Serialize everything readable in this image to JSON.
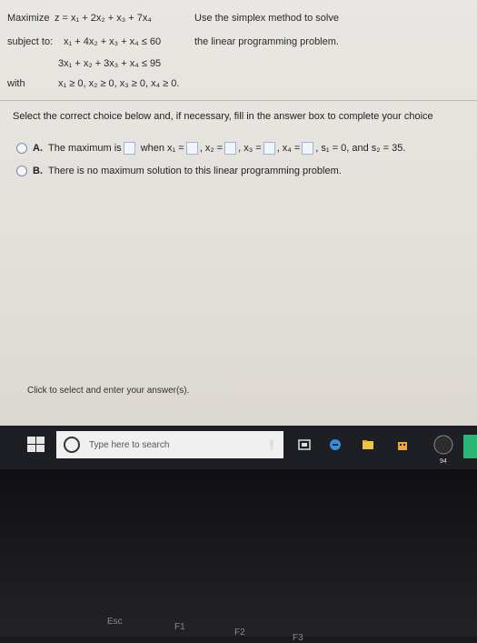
{
  "problem": {
    "maximize_label": "Maximize",
    "objective": "z = x₁ + 2x₂ + x₃ + 7x₄",
    "subject_label": "subject to:",
    "constraint1": "x₁ + 4x₂ + x₃ + x₄ ≤ 60",
    "constraint2": "3x₁ + x₂ + 3x₃ + x₄ ≤ 95",
    "with_label": "with",
    "nonneg": "x₁ ≥ 0, x₂ ≥ 0, x₃ ≥ 0, x₄ ≥ 0.",
    "hint_line1": "Use the simplex method to solve",
    "hint_line2": "the linear programming problem."
  },
  "instruction": "Select the correct choice below and, if necessary, fill in the answer box to complete your choice",
  "choices": {
    "a": {
      "letter": "A.",
      "text1": "The maximum is",
      "text2": "when x₁ =",
      "text3": ", x₂ =",
      "text4": ", x₃ =",
      "text5": ", x₄ =",
      "text6": ", s₁ = 0, and s₂ = 35."
    },
    "b": {
      "letter": "B.",
      "text": "There is no maximum solution to this linear programming problem."
    }
  },
  "status_text": "Click to select and enter your answer(s).",
  "taskbar": {
    "search_placeholder": "Type here to search",
    "badge": "94"
  },
  "keyboard": {
    "esc": "Esc",
    "f1": "F1",
    "f2": "F2",
    "f3": "F3"
  },
  "colors": {
    "radio_border": "#6f8fb6",
    "answer_box_border": "#9bb5d4",
    "taskbar_bg": "#1d1f24"
  }
}
